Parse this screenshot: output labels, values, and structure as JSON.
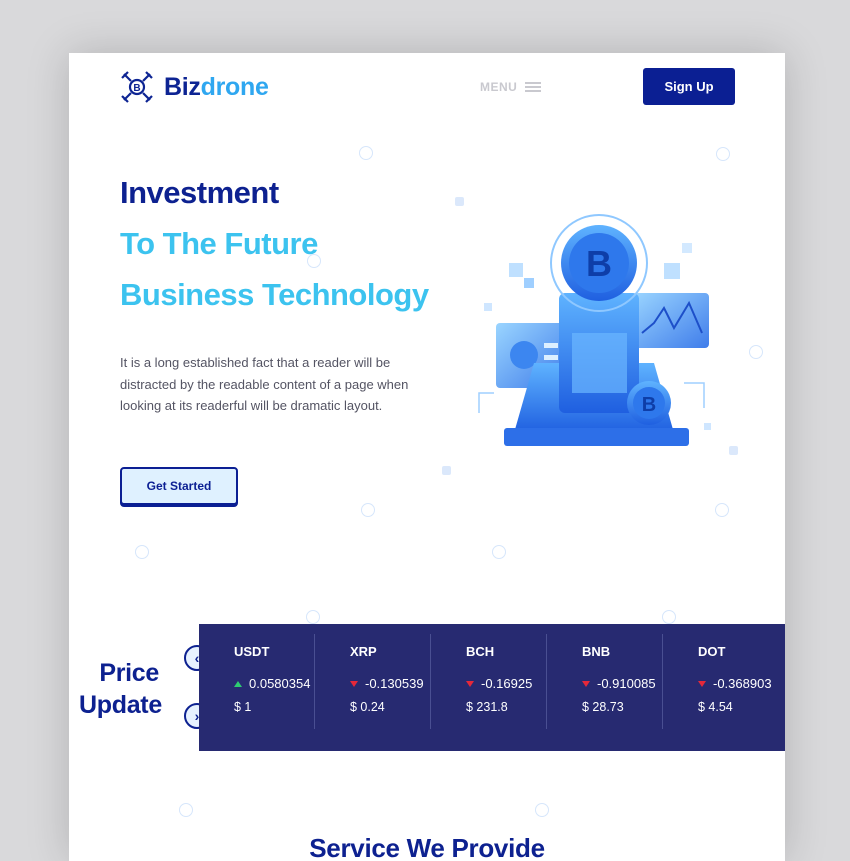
{
  "header": {
    "logo_primary": "Biz",
    "logo_secondary": "drone",
    "menu_label": "MENU",
    "signup_label": "Sign Up"
  },
  "hero": {
    "title_line1": "Investment",
    "title_line2": "To The Future",
    "title_line3": "Business Technology",
    "description": "It is a long established fact that a reader will be distracted by the readable content of a page when looking at its readerful will be dramatic layout.",
    "cta_label": "Get Started"
  },
  "price_update": {
    "title": "Price Update",
    "coins": [
      {
        "symbol": "USDT",
        "change": "0.0580354",
        "direction": "up",
        "price": "$ 1"
      },
      {
        "symbol": "XRP",
        "change": "-0.130539",
        "direction": "down",
        "price": "$ 0.24"
      },
      {
        "symbol": "BCH",
        "change": "-0.16925",
        "direction": "down",
        "price": "$ 231.8"
      },
      {
        "symbol": "BNB",
        "change": "-0.910085",
        "direction": "down",
        "price": "$ 28.73"
      },
      {
        "symbol": "DOT",
        "change": "-0.368903",
        "direction": "down",
        "price": "$ 4.54"
      }
    ]
  },
  "services": {
    "title": "Service We Provide"
  },
  "colors": {
    "brand_dark": "#0b1f93",
    "brand_light": "#3cc3ef",
    "ticker_bg": "#272a71",
    "up": "#2ecc71",
    "down": "#e5283a"
  },
  "icons": [
    "drone-logo-icon",
    "menu-icon",
    "chevron-left-icon",
    "chevron-right-icon",
    "bitcoin-illustration"
  ]
}
